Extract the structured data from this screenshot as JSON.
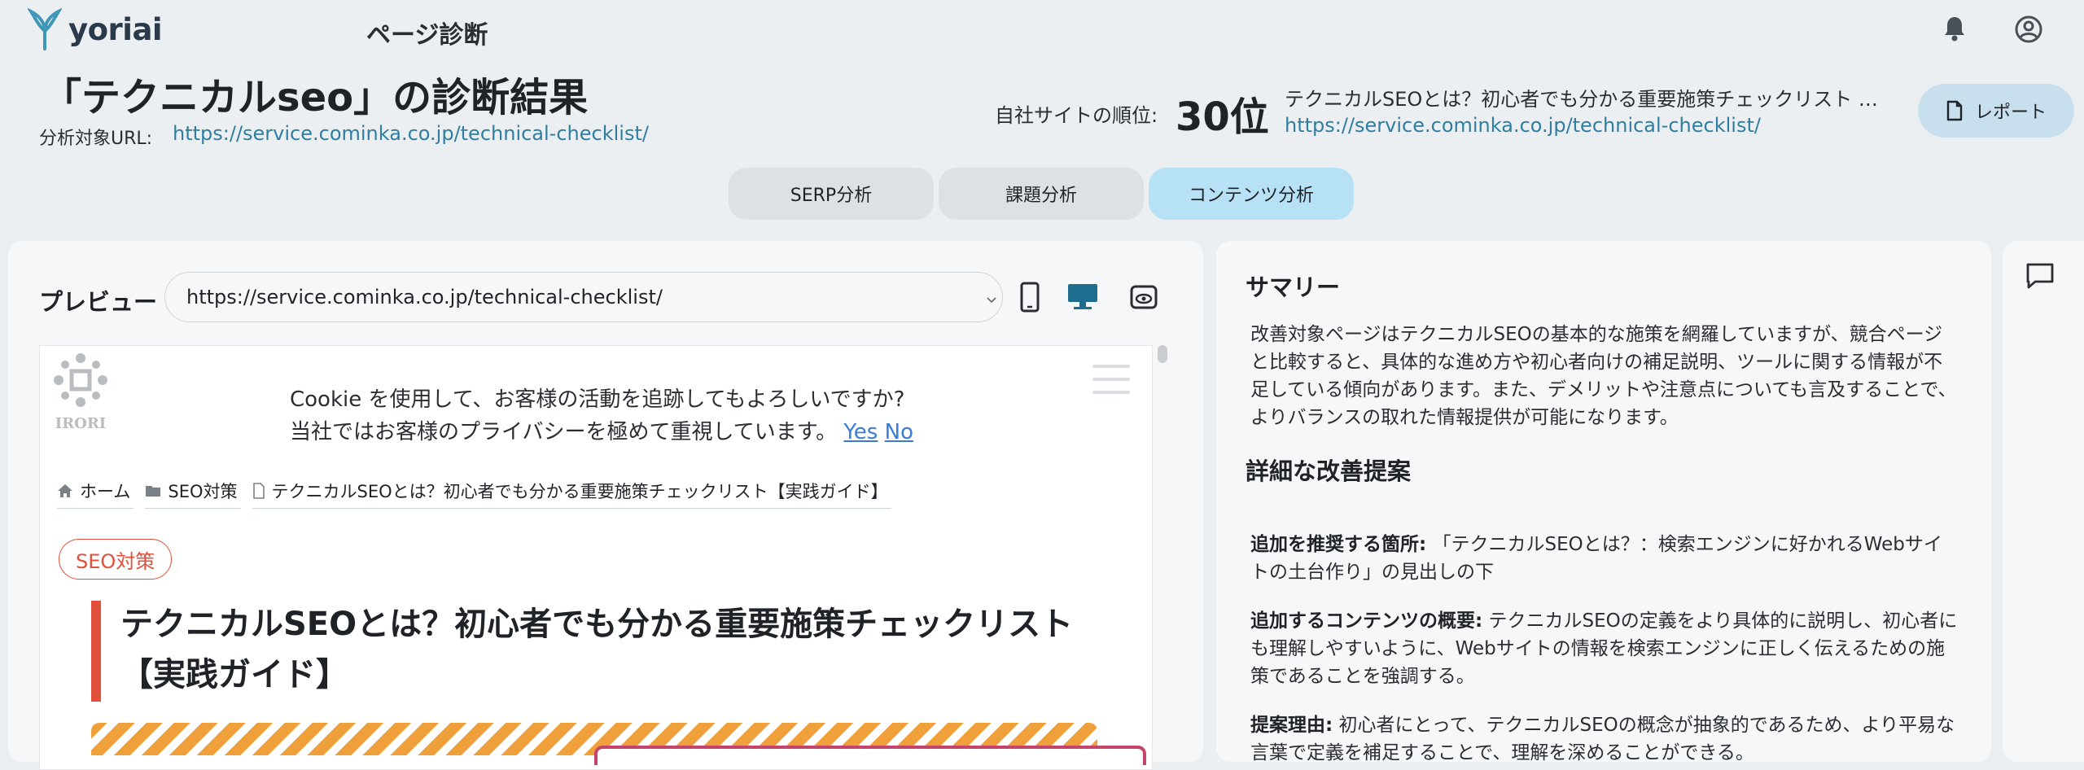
{
  "app": {
    "logo_text": "yoriai",
    "page_title": "ページ診断"
  },
  "header": {
    "title": "「テクニカルseo」の診断結果",
    "url_label": "分析対象URL:",
    "url": "https://service.cominka.co.jp/technical-checklist/",
    "rank_label": "自社サイトの順位:",
    "rank_value": "30位",
    "rank_page_title": "テクニカルSEOとは？初心者でも分かる重要施策チェックリスト …",
    "rank_page_url": "https://service.cominka.co.jp/technical-checklist/",
    "report_button": "レポート"
  },
  "tabs": [
    {
      "label": "SERP分析",
      "active": false
    },
    {
      "label": "課題分析",
      "active": false
    },
    {
      "label": "コンテンツ分析",
      "active": true
    }
  ],
  "preview": {
    "label": "プレビュー",
    "selected_url": "https://service.cominka.co.jp/technical-checklist/",
    "site_logo": "IRORI",
    "cookie_line1": "Cookie を使用して、お客様の活動を追跡してもよろしいですか?",
    "cookie_line2": "当社ではお客様のプライバシーを極めて重視しています。",
    "cookie_yes": "Yes",
    "cookie_no": "No",
    "breadcrumbs": [
      {
        "icon": "home-icon",
        "label": "ホーム"
      },
      {
        "icon": "folder-icon",
        "label": "SEO対策"
      },
      {
        "icon": "file-icon",
        "label": "テクニカルSEOとは？初心者でも分かる重要施策チェックリスト【実践ガイド】"
      }
    ],
    "category_badge": "SEO対策",
    "article_title": "テクニカルSEOとは？初心者でも分かる重要施策チェックリスト【実践ガイド】"
  },
  "summary": {
    "heading": "サマリー",
    "text": "改善対象ページはテクニカルSEOの基本的な施策を網羅していますが、競合ページと比較すると、具体的な進め方や初心者向けの補足説明、ツールに関する情報が不足している傾向があります。また、デメリットや注意点についても言及することで、よりバランスの取れた情報提供が可能になります。",
    "detail_heading": "詳細な改善提案",
    "items": [
      {
        "label": "追加を推奨する箇所:",
        "text": "「テクニカルSEOとは？：検索エンジンに好かれるWebサイトの土台作り」の見出しの下"
      },
      {
        "label": "追加するコンテンツの概要:",
        "text": "テクニカルSEOの定義をより具体的に説明し、初心者にも理解しやすいように、Webサイトの情報を検索エンジンに正しく伝えるための施策であることを強調する。"
      },
      {
        "label": "提案理由:",
        "text": "初心者にとって、テクニカルSEOの概念が抽象的であるため、より平易な言葉で定義を補足することで、理解を深めることができる。"
      }
    ]
  },
  "colors": {
    "accent": "#b7e1f5",
    "link": "#2f7ea0",
    "brand_red": "#e0503a"
  }
}
